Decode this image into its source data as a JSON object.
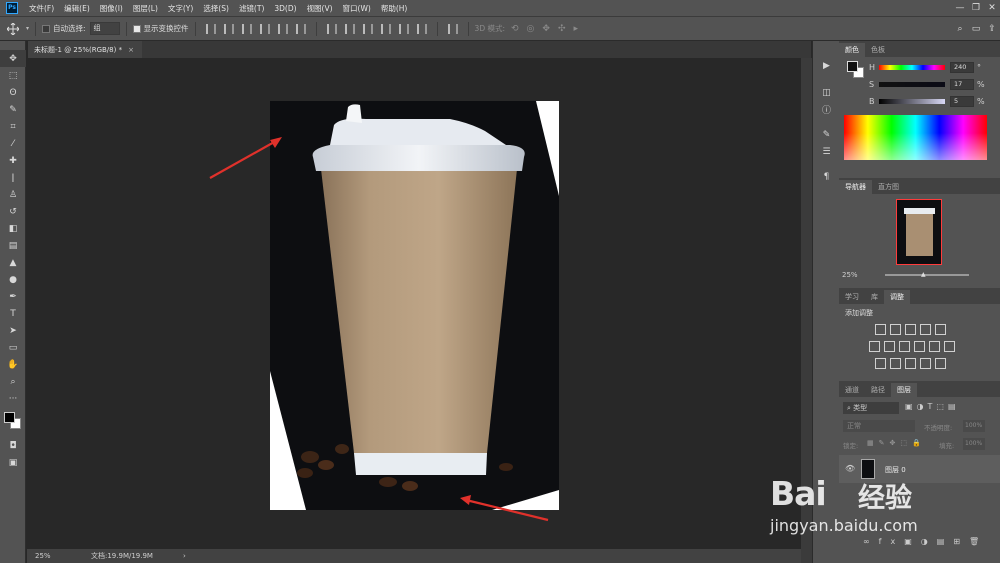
{
  "menu": {
    "logo": "Ps",
    "items": [
      "文件(F)",
      "编辑(E)",
      "图像(I)",
      "图层(L)",
      "文字(Y)",
      "选择(S)",
      "滤镜(T)",
      "3D(D)",
      "视图(V)",
      "窗口(W)",
      "帮助(H)"
    ]
  },
  "options": {
    "auto_select_label": "自动选择:",
    "auto_select_value": "组",
    "show_transform_label": "显示变换控件",
    "mode_3d_label": "3D 模式:"
  },
  "document": {
    "tab_title": "未标题-1 @ 25%(RGB/8) *",
    "close_glyph": "×"
  },
  "status": {
    "zoom": "25%",
    "doc_info": "文档:19.9M/19.9M",
    "arrow": "›"
  },
  "color_panel": {
    "tabs": [
      "颜色",
      "色板"
    ],
    "h_label": "H",
    "h_value": "240",
    "s_label": "S",
    "s_value": "17",
    "b_label": "B",
    "b_value": "5",
    "unit_deg": "°",
    "unit_pct": "%"
  },
  "navigator_panel": {
    "tabs": [
      "导航器",
      "直方图"
    ],
    "zoom": "25%"
  },
  "adjust_panel": {
    "tabs": [
      "学习",
      "库",
      "调整"
    ],
    "title": "添加调整"
  },
  "layers_panel": {
    "tabs": [
      "通道",
      "路径",
      "图层"
    ],
    "filter_label": "类型",
    "blend_mode": "正常",
    "opacity_label": "不透明度:",
    "opacity_value": "100%",
    "lock_label": "锁定:",
    "fill_label": "填充:",
    "fill_value": "100%",
    "layer_name": "图层 0"
  },
  "watermark": {
    "brand": "Bai",
    "brand2": "经验",
    "url": "jingyan.baidu.com"
  },
  "colors": {
    "accent": "#31a8ff",
    "annotation_arrow": "#e0312b",
    "panel_bg": "#535353",
    "workspace_bg": "#282828"
  }
}
